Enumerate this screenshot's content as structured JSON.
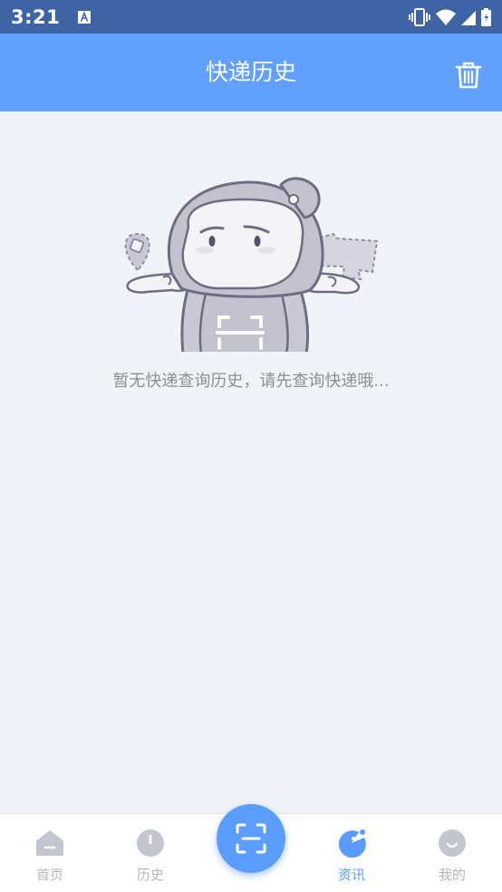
{
  "status_bar": {
    "time": "3:21",
    "icons": [
      "a-notification-icon",
      "vibrate-icon",
      "wifi-icon",
      "signal-icon",
      "battery-icon"
    ]
  },
  "header": {
    "title": "快递历史",
    "action_icon": "trash-icon"
  },
  "empty_state": {
    "illustration": "mascot-shrug",
    "message": "暂无快递查询历史，请先查询快递哦..."
  },
  "bottom_nav": {
    "items": [
      {
        "label": "首页",
        "icon": "home-icon",
        "active": false
      },
      {
        "label": "历史",
        "icon": "clock-icon",
        "active": false
      },
      {
        "label": "资讯",
        "icon": "news-icon",
        "active": true
      },
      {
        "label": "我的",
        "icon": "profile-icon",
        "active": false
      }
    ],
    "center_action_icon": "scan-icon"
  },
  "colors": {
    "status_bar": "#3f64a6",
    "header": "#61a0ff",
    "background": "#f0f4f8",
    "accent": "#5a9bff",
    "inactive": "#b3b7bf"
  }
}
